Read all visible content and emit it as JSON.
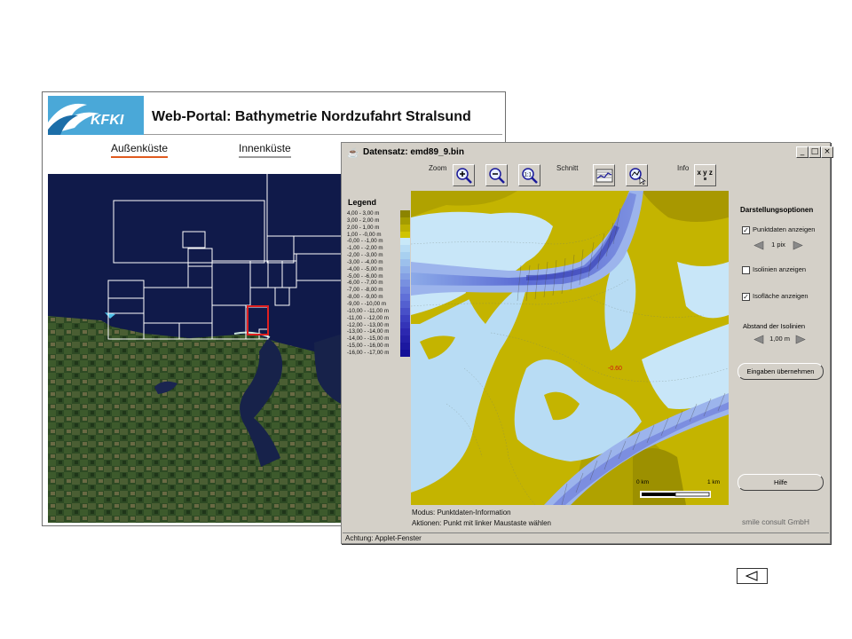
{
  "portal": {
    "logo_text": "KFKI",
    "title": "Web-Portal: Bathymetrie Nordzufahrt Stralsund",
    "tabs": [
      {
        "label": "Außenküste",
        "underline": "#e05a1f"
      },
      {
        "label": "Innenküste",
        "underline": "#9a9a9a"
      }
    ],
    "highlight_color": "#e02020"
  },
  "applet": {
    "title": "Datensatz: emd89_9.bin",
    "window_buttons": [
      "_",
      "□",
      "×"
    ],
    "toolbar": {
      "zoom_label": "Zoom",
      "schnitt_label": "Schnitt",
      "info_label": "Info",
      "tools": [
        {
          "icon": "zoom-in-icon",
          "group": "Zoom"
        },
        {
          "icon": "zoom-out-icon",
          "group": "Zoom"
        },
        {
          "icon": "zoom-reset-icon",
          "group": "Zoom",
          "text": "1:1"
        },
        {
          "icon": "profile-section-icon",
          "group": "Schnitt"
        },
        {
          "icon": "section-select-icon",
          "group": "Schnitt"
        },
        {
          "icon": "xyz-info-icon",
          "group": "Info",
          "text": "x y z"
        }
      ]
    },
    "legend": {
      "title": "Legend",
      "entries": [
        {
          "label": "4,00 - 3,00 m",
          "color": "#8c8400"
        },
        {
          "label": "3,00 - 2,00 m",
          "color": "#a49c00"
        },
        {
          "label": "2,00 - 1,00 m",
          "color": "#bcb000"
        },
        {
          "label": "1,00 - -0,00 m",
          "color": "#d0c400"
        },
        {
          "label": "-0,00 - -1,00 m",
          "color": "#c8e8f8"
        },
        {
          "label": "-1,00 - -2,00 m",
          "color": "#b8dcf4"
        },
        {
          "label": "-2,00 - -3,00 m",
          "color": "#a8d0f0"
        },
        {
          "label": "-3,00 - -4,00 m",
          "color": "#9cc0ec"
        },
        {
          "label": "-4,00 - -5,00 m",
          "color": "#90b0e8"
        },
        {
          "label": "-5,00 - -6,00 m",
          "color": "#84a0e4"
        },
        {
          "label": "-6,00 - -7,00 m",
          "color": "#7890e0"
        },
        {
          "label": "-7,00 - -8,00 m",
          "color": "#6c80dc"
        },
        {
          "label": "-8,00 - -9,00 m",
          "color": "#6070d8"
        },
        {
          "label": "-9,00 - -10,00 m",
          "color": "#5460d0"
        },
        {
          "label": "-10,00 - -11,00 m",
          "color": "#4850c8"
        },
        {
          "label": "-11,00 - -12,00 m",
          "color": "#3c40c0"
        },
        {
          "label": "-12,00 - -13,00 m",
          "color": "#3434b8"
        },
        {
          "label": "-13,00 - -14,00 m",
          "color": "#2c28b0"
        },
        {
          "label": "-14,00 - -15,00 m",
          "color": "#2420a8"
        },
        {
          "label": "-15,00 - -16,00 m",
          "color": "#1c18a0"
        },
        {
          "label": "-16,00 - -17,00 m",
          "color": "#141098"
        }
      ]
    },
    "map": {
      "point_label": "-0.60",
      "scale_start": "0 km",
      "scale_end": "1 km"
    },
    "options": {
      "title": "Darstellungsoptionen",
      "punktdaten": {
        "label": "Punktdaten anzeigen",
        "checked": true
      },
      "punkt_size": "1 pix",
      "isolinien": {
        "label": "Isolinien anzeigen",
        "checked": false
      },
      "isoflaeche": {
        "label": "Isofläche anzeigen",
        "checked": true
      },
      "abstand_label": "Abstand der Isolinien",
      "abstand_value": "1,00 m",
      "apply_button": "Eingaben übernehmen",
      "help_button": "Hilfe"
    },
    "status": {
      "modus": "Modus: Punktdaten-Information",
      "aktionen": "Aktionen: Punkt mit linker Maustaste wählen",
      "copyright": "smile consult GmbH",
      "warning": "Achtung: Applet-Fenster"
    }
  }
}
